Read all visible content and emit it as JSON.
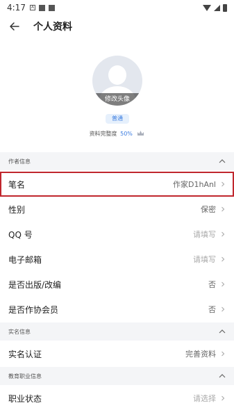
{
  "status_bar": {
    "time": "4:17",
    "icon_a": "A"
  },
  "header": {
    "title": "个人资料"
  },
  "profile": {
    "avatar_edit_label": "修改头像",
    "level_badge": "普通",
    "completeness_label": "资料完整度",
    "completeness_value": "50%",
    "completeness_fraction": 0.5
  },
  "sections": {
    "author": {
      "title": "作者信息",
      "rows": [
        {
          "label": "笔名",
          "value": "作家D1hAnl"
        },
        {
          "label": "性别",
          "value": "保密"
        },
        {
          "label": "QQ 号",
          "value": "请填写"
        },
        {
          "label": "电子邮箱",
          "value": "请填写"
        },
        {
          "label": "是否出版/改编",
          "value": "否"
        },
        {
          "label": "是否作协会员",
          "value": "否"
        }
      ]
    },
    "realname": {
      "title": "实名信息",
      "rows": [
        {
          "label": "实名认证",
          "value": "完善资料"
        }
      ]
    },
    "career": {
      "title": "教育职业信息",
      "rows": [
        {
          "label": "职业状态",
          "value": "请选择"
        }
      ]
    }
  },
  "colors": {
    "accent": "#3a7ce0",
    "highlight": "#c0262d",
    "section_bg": "#f4f5f7"
  },
  "icons": {
    "back": "arrow-left-icon",
    "collapse": "chevron-up-icon",
    "row_arrow": "chevron-right-icon",
    "crown": "crown-icon"
  }
}
